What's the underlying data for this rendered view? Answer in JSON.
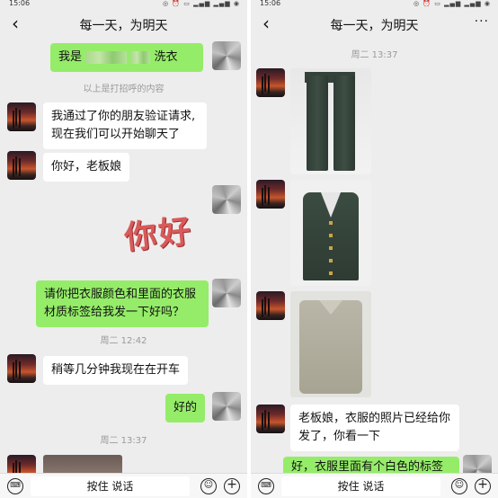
{
  "status": {
    "time": "15:06",
    "icons": "◎ ⏰ ▭ ▂▄▆ ▂▄▆ ◉"
  },
  "chat": {
    "title": "每一天，为明天",
    "back_label": "‹",
    "more_label": "···"
  },
  "left": {
    "greeting_prefix": "我是",
    "greeting_suffix": "洗衣",
    "system_note": "以上是打招呼的内容",
    "msg_verified_line1": "我通过了你的朋友验证请求,",
    "msg_verified_line2": "现在我们可以开始聊天了",
    "msg_hello": "你好，老板娘",
    "sticker": "你好",
    "msg_request_line1": "请你把衣服颜色和里面的衣服",
    "msg_request_line2": "材质标签给我发一下好吗？",
    "time_1242": "周二 12:42",
    "msg_driving": "稍等几分钟我现在在开车",
    "msg_ok": "好的",
    "time_1337": "周二 13:37"
  },
  "right": {
    "time_1337": "周二 13:37",
    "msg_photos_line1": "老板娘，衣服的照片已经给你",
    "msg_photos_line2": "发了，你看一下",
    "msg_label_partial": "好，衣服里面有个白色的标签"
  },
  "input": {
    "hold_to_talk": "按住 说话",
    "keyboard_glyph": "⌨",
    "emoji_glyph": "☺",
    "plus_glyph": "+"
  },
  "colors": {
    "chat_bg": "#ededed",
    "outgoing_bubble": "#95ec69",
    "incoming_bubble": "#ffffff"
  },
  "icons": [
    "back-arrow-icon",
    "more-dots-icon",
    "keyboard-icon",
    "emoji-icon",
    "plus-icon"
  ]
}
